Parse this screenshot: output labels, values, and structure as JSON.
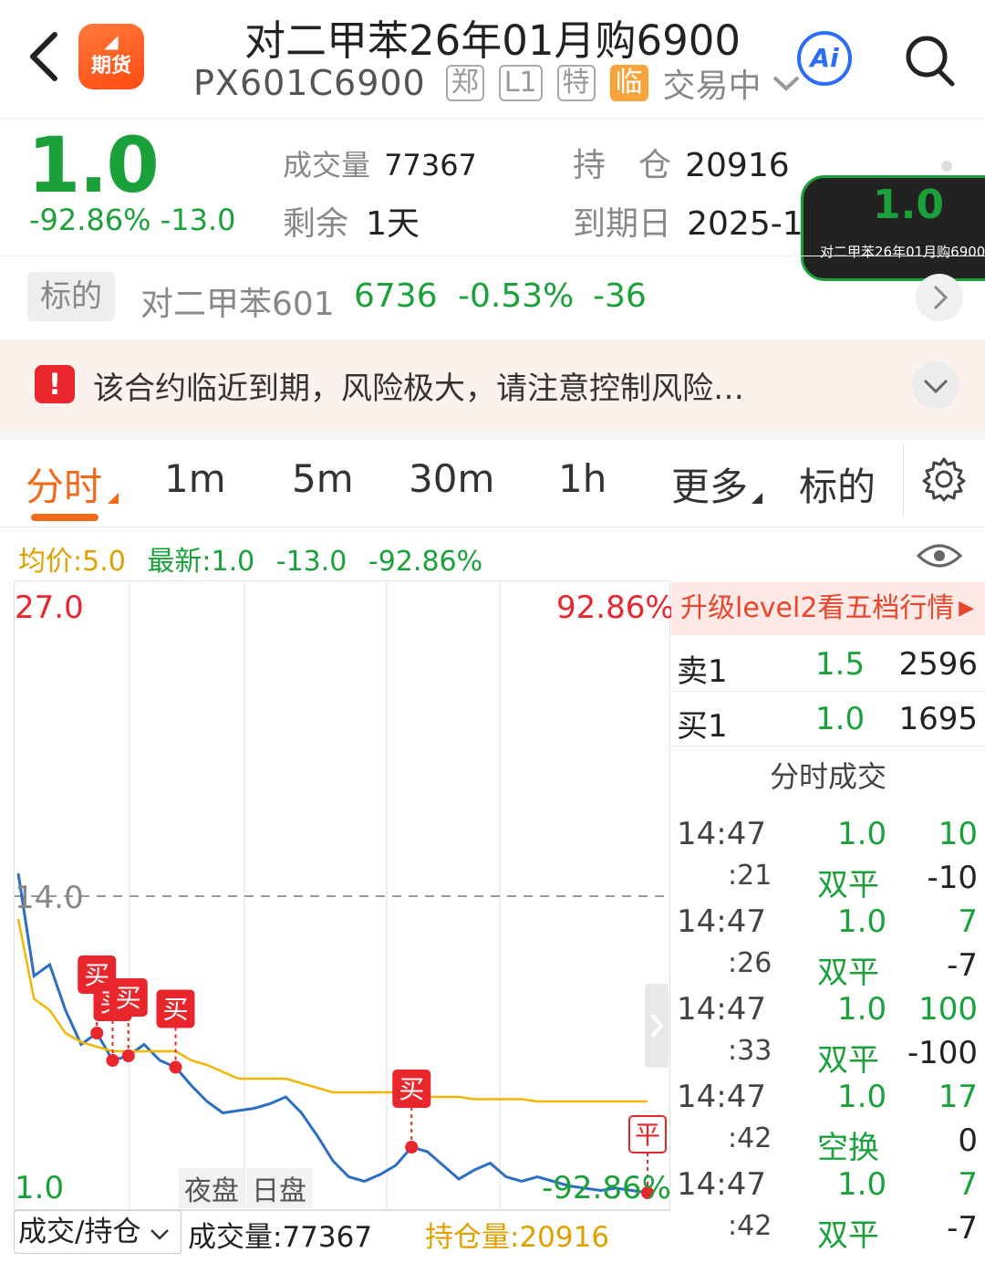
{
  "header": {
    "app_logo_top": "",
    "app_logo_text": "期货",
    "title": "对二甲苯26年01月购6900",
    "code": "PX601C6900",
    "tags": [
      "郑",
      "L1",
      "特",
      "临"
    ],
    "status": "交易中",
    "ai_label": "Ai"
  },
  "quote": {
    "price": "1.0",
    "change_pct": "-92.86%",
    "change": "-13.0",
    "volume_label": "成交量",
    "volume": "77367",
    "remaining_label": "剩余",
    "remaining": "1天",
    "oi_label": "持　仓",
    "oi": "20916",
    "expiry_label": "到期日",
    "expiry": "2025-11-26"
  },
  "float_widget": {
    "price": "1.0",
    "name": "对二甲苯26年01月购6900"
  },
  "underlying": {
    "tag": "标的",
    "name": "对二甲苯601",
    "price": "6736",
    "change_pct": "-0.53%",
    "change": "-36"
  },
  "warning": {
    "text": "该合约临近到期，风险极大，请注意控制风险…"
  },
  "tabs": [
    "分时",
    "1m",
    "5m",
    "30m",
    "1h",
    "更多",
    "标的"
  ],
  "info_bar": {
    "avg": "均价:5.0",
    "latest": "最新:1.0",
    "change": "-13.0",
    "pct": "-92.86%"
  },
  "chart_data": {
    "type": "line",
    "y_top_label": "27.0",
    "y_mid_label": "14.0",
    "y_bottom_label": "1.0",
    "right_top_pct": "92.86%",
    "right_bottom_pct": "-92.86%",
    "ylim": [
      1.0,
      27.0
    ],
    "session_labels": [
      "夜盘",
      "日盘"
    ],
    "series": [
      {
        "name": "price",
        "color": "#2a6fc4",
        "values": [
          15,
          10.5,
          11,
          9,
          7.5,
          8,
          6.8,
          7,
          7.5,
          6.8,
          6.5,
          5.7,
          5,
          4.5,
          4.6,
          4.7,
          4.9,
          5.2,
          4.5,
          3.5,
          2.4,
          1.7,
          1.5,
          1.8,
          2.2,
          3.0,
          2.8,
          2.2,
          1.6,
          2.0,
          2.3,
          1.7,
          1.5,
          1.7,
          1.5,
          1.3,
          1.2,
          1.1,
          1.2,
          1.1,
          1.0
        ]
      },
      {
        "name": "avg",
        "color": "#f2b705",
        "values": [
          13,
          9.5,
          9,
          8,
          7.6,
          7.4,
          7.2,
          7.2,
          7.2,
          7.2,
          7.2,
          6.8,
          6.6,
          6.3,
          6.0,
          6.0,
          6.0,
          6.0,
          5.8,
          5.6,
          5.4,
          5.4,
          5.4,
          5.4,
          5.4,
          5.4,
          5.2,
          5.2,
          5.2,
          5.1,
          5.1,
          5.1,
          5.1,
          5.0,
          5.0,
          5.0,
          5.0,
          5.0,
          5.0,
          5.0,
          5.0
        ]
      }
    ],
    "markers": [
      {
        "label": "买",
        "index": 5
      },
      {
        "label": "买",
        "index": 6
      },
      {
        "label": "买",
        "index": 7
      },
      {
        "label": "买",
        "index": 10
      },
      {
        "label": "买",
        "index": 25
      },
      {
        "label": "平",
        "index": 40
      }
    ]
  },
  "orderbook": {
    "level2_prompt": "升级level2看五档行情",
    "rows": [
      {
        "side": "卖1",
        "price": "1.5",
        "qty": "2596"
      },
      {
        "side": "买1",
        "price": "1.0",
        "qty": "1695"
      }
    ]
  },
  "trades": {
    "title": "分时成交",
    "rows": [
      {
        "time": "14:47",
        "price": "1.0",
        "qty": "10",
        "price_color": "#1aa13a",
        "qty_color": "#1aa13a"
      },
      {
        "time": ":21",
        "price": "双平",
        "qty": "-10",
        "price_color": "#1aa13a",
        "qty_color": "#222"
      },
      {
        "time": "14:47",
        "price": "1.0",
        "qty": "7",
        "price_color": "#1aa13a",
        "qty_color": "#1aa13a"
      },
      {
        "time": ":26",
        "price": "双平",
        "qty": "-7",
        "price_color": "#1aa13a",
        "qty_color": "#222"
      },
      {
        "time": "14:47",
        "price": "1.0",
        "qty": "100",
        "price_color": "#1aa13a",
        "qty_color": "#1aa13a"
      },
      {
        "time": ":33",
        "price": "双平",
        "qty": "-100",
        "price_color": "#1aa13a",
        "qty_color": "#222"
      },
      {
        "time": "14:47",
        "price": "1.0",
        "qty": "17",
        "price_color": "#1aa13a",
        "qty_color": "#1aa13a"
      },
      {
        "time": ":42",
        "price": "空换",
        "qty": "0",
        "price_color": "#1aa13a",
        "qty_color": "#222"
      },
      {
        "time": "14:47",
        "price": "1.0",
        "qty": "7",
        "price_color": "#1aa13a",
        "qty_color": "#1aa13a"
      },
      {
        "time": ":42",
        "price": "双平",
        "qty": "-7",
        "price_color": "#1aa13a",
        "qty_color": "#222"
      }
    ]
  },
  "bottom": {
    "selector": "成交/持仓",
    "volume": "成交量:77367",
    "oi": "持仓量:20916"
  }
}
